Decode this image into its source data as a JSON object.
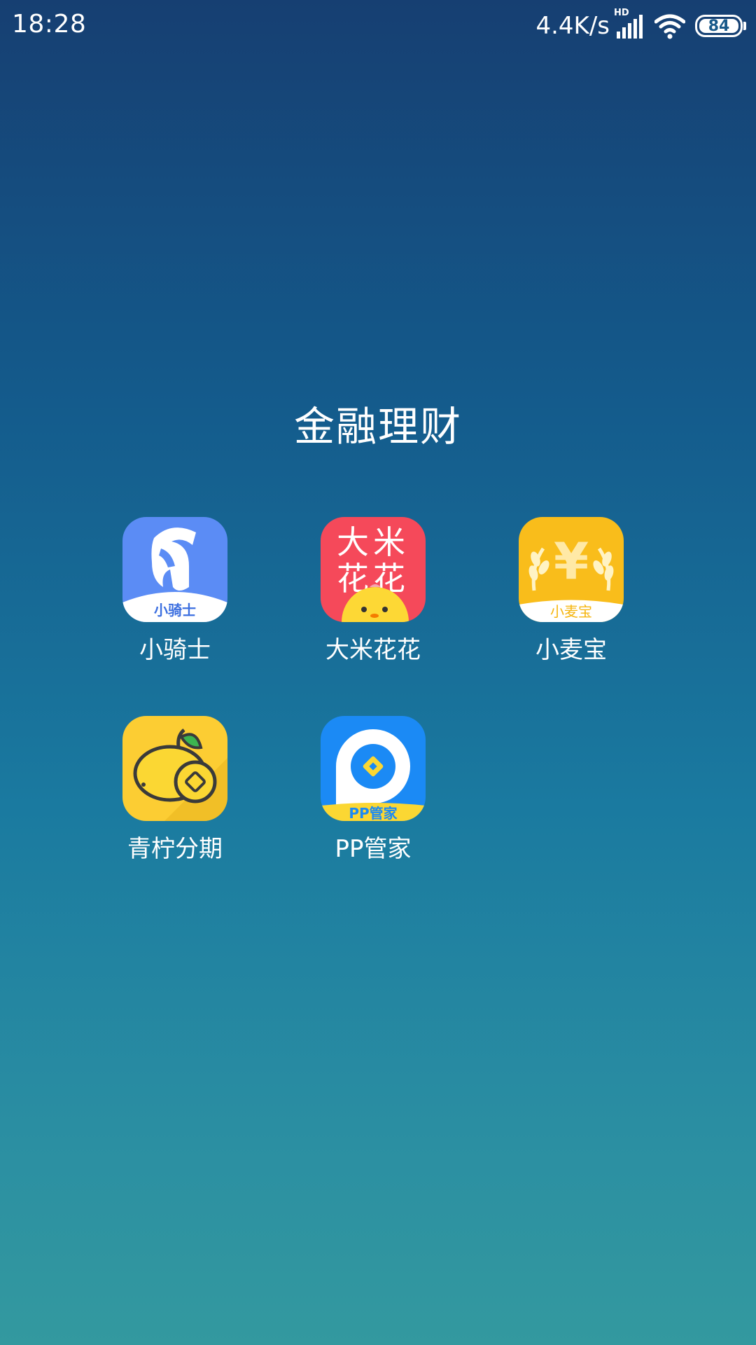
{
  "status_bar": {
    "time": "18:28",
    "network_speed": "4.4K/s",
    "signal_tag": "HD",
    "battery_level": "84",
    "icons": [
      "signal-icon",
      "wifi-icon",
      "battery-icon"
    ]
  },
  "folder": {
    "title": "金融理财",
    "apps": [
      {
        "label": "小骑士",
        "icon": "knight-helmet-icon",
        "icon_text": "小骑士",
        "color": "#5b8cf5"
      },
      {
        "label": "大米花花",
        "icon": "chick-icon",
        "icon_text": "大米花花",
        "color": "#f5495a"
      },
      {
        "label": "小麦宝",
        "icon": "wheat-yuan-icon",
        "icon_text": "小麦宝",
        "color": "#f9bd1b"
      },
      {
        "label": "青柠分期",
        "icon": "lemon-coin-icon",
        "color": "#fccd33"
      },
      {
        "label": "PP管家",
        "icon": "pp-coin-icon",
        "icon_text": "PP管家",
        "color": "#1b8af5"
      }
    ]
  }
}
